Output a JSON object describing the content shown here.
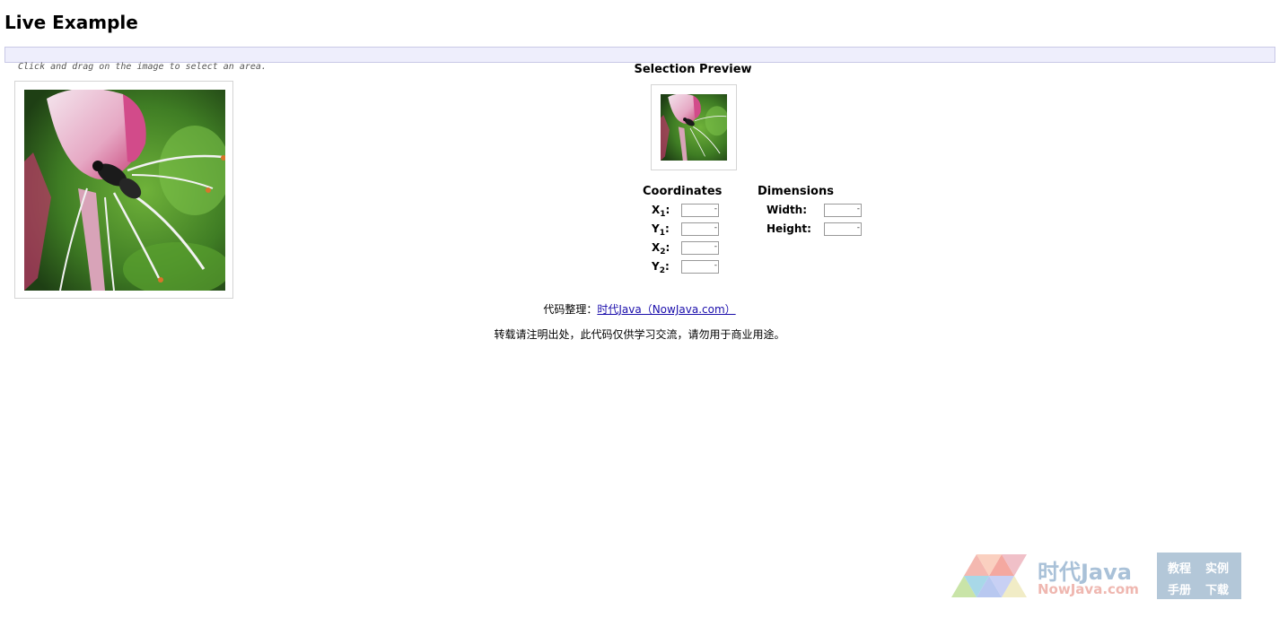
{
  "page": {
    "title": "Live Example",
    "hint": "Click and drag on the image to select an area."
  },
  "preview": {
    "title": "Selection Preview"
  },
  "coordinates": {
    "heading": "Coordinates",
    "x1_label": "X",
    "x1_sub": "1",
    "y1_label": "Y",
    "y1_sub": "1",
    "x2_label": "X",
    "x2_sub": "2",
    "y2_label": "Y",
    "y2_sub": "2",
    "x1_value": "",
    "y1_value": "",
    "x2_value": "",
    "y2_value": ""
  },
  "dimensions": {
    "heading": "Dimensions",
    "width_label": "Width:",
    "height_label": "Height:",
    "width_value": "",
    "height_value": ""
  },
  "credit": {
    "prefix": "代码整理：",
    "link_text": "时代Java（NowJava.com）",
    "notice": "转载请注明出处，此代码仅供学习交流，请勿用于商业用途。"
  },
  "logo": {
    "cn_text": "时代Java",
    "en_text": "NowJava.com",
    "box_1": "教程",
    "box_2": "实例",
    "box_3": "手册",
    "box_4": "下载"
  },
  "colors": {
    "link": "#1a0dab",
    "bar": "#eeeefc",
    "logo_blue": "#a9c1d8",
    "logo_pink": "#efb7b0"
  }
}
